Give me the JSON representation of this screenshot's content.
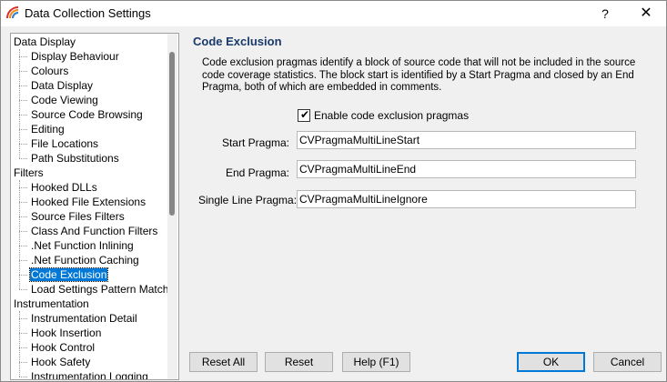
{
  "window": {
    "title": "Data Collection Settings",
    "help_glyph": "?",
    "close_glyph": "✕"
  },
  "tree": {
    "items": [
      {
        "label": "Data Display",
        "level": 0
      },
      {
        "label": "Display Behaviour",
        "level": 1
      },
      {
        "label": "Colours",
        "level": 1
      },
      {
        "label": "Data Display",
        "level": 1
      },
      {
        "label": "Code Viewing",
        "level": 1
      },
      {
        "label": "Source Code Browsing",
        "level": 1
      },
      {
        "label": "Editing",
        "level": 1
      },
      {
        "label": "File Locations",
        "level": 1
      },
      {
        "label": "Path Substitutions",
        "level": 1
      },
      {
        "label": "Filters",
        "level": 0
      },
      {
        "label": "Hooked DLLs",
        "level": 1
      },
      {
        "label": "Hooked File Extensions",
        "level": 1
      },
      {
        "label": "Source Files Filters",
        "level": 1
      },
      {
        "label": "Class And Function Filters",
        "level": 1
      },
      {
        "label": ".Net Function Inlining",
        "level": 1
      },
      {
        "label": ".Net Function Caching",
        "level": 1
      },
      {
        "label": "Code Exclusion",
        "level": 1,
        "selected": true
      },
      {
        "label": "Load Settings Pattern Match",
        "level": 1
      },
      {
        "label": "Instrumentation",
        "level": 0
      },
      {
        "label": "Instrumentation Detail",
        "level": 1
      },
      {
        "label": "Hook Insertion",
        "level": 1
      },
      {
        "label": "Hook Control",
        "level": 1
      },
      {
        "label": "Hook Safety",
        "level": 1
      },
      {
        "label": "Instrumentation Logging",
        "level": 1
      }
    ]
  },
  "panel": {
    "title": "Code Exclusion",
    "description": "Code exclusion pragmas identify a block of source code that will not be included in the source code coverage statistics. The block start is identified by a Start Pragma and closed by an End Pragma, both of which are embedded in comments.",
    "enable_checkbox": {
      "label": "Enable code exclusion pragmas",
      "checked": true,
      "mark": "✔"
    },
    "start_pragma": {
      "label": "Start Pragma:",
      "value": "CVPragmaMultiLineStart"
    },
    "end_pragma": {
      "label": "End Pragma:",
      "value": "CVPragmaMultiLineEnd"
    },
    "single_line_pragma": {
      "label": "Single Line Pragma:",
      "value": "CVPragmaMultiLineIgnore"
    }
  },
  "buttons": {
    "reset_all": "Reset All",
    "reset": "Reset",
    "help": "Help (F1)",
    "ok": "OK",
    "cancel": "Cancel"
  },
  "colors": {
    "selection": "#0078d7",
    "title_accent": "#1a3a6b"
  }
}
